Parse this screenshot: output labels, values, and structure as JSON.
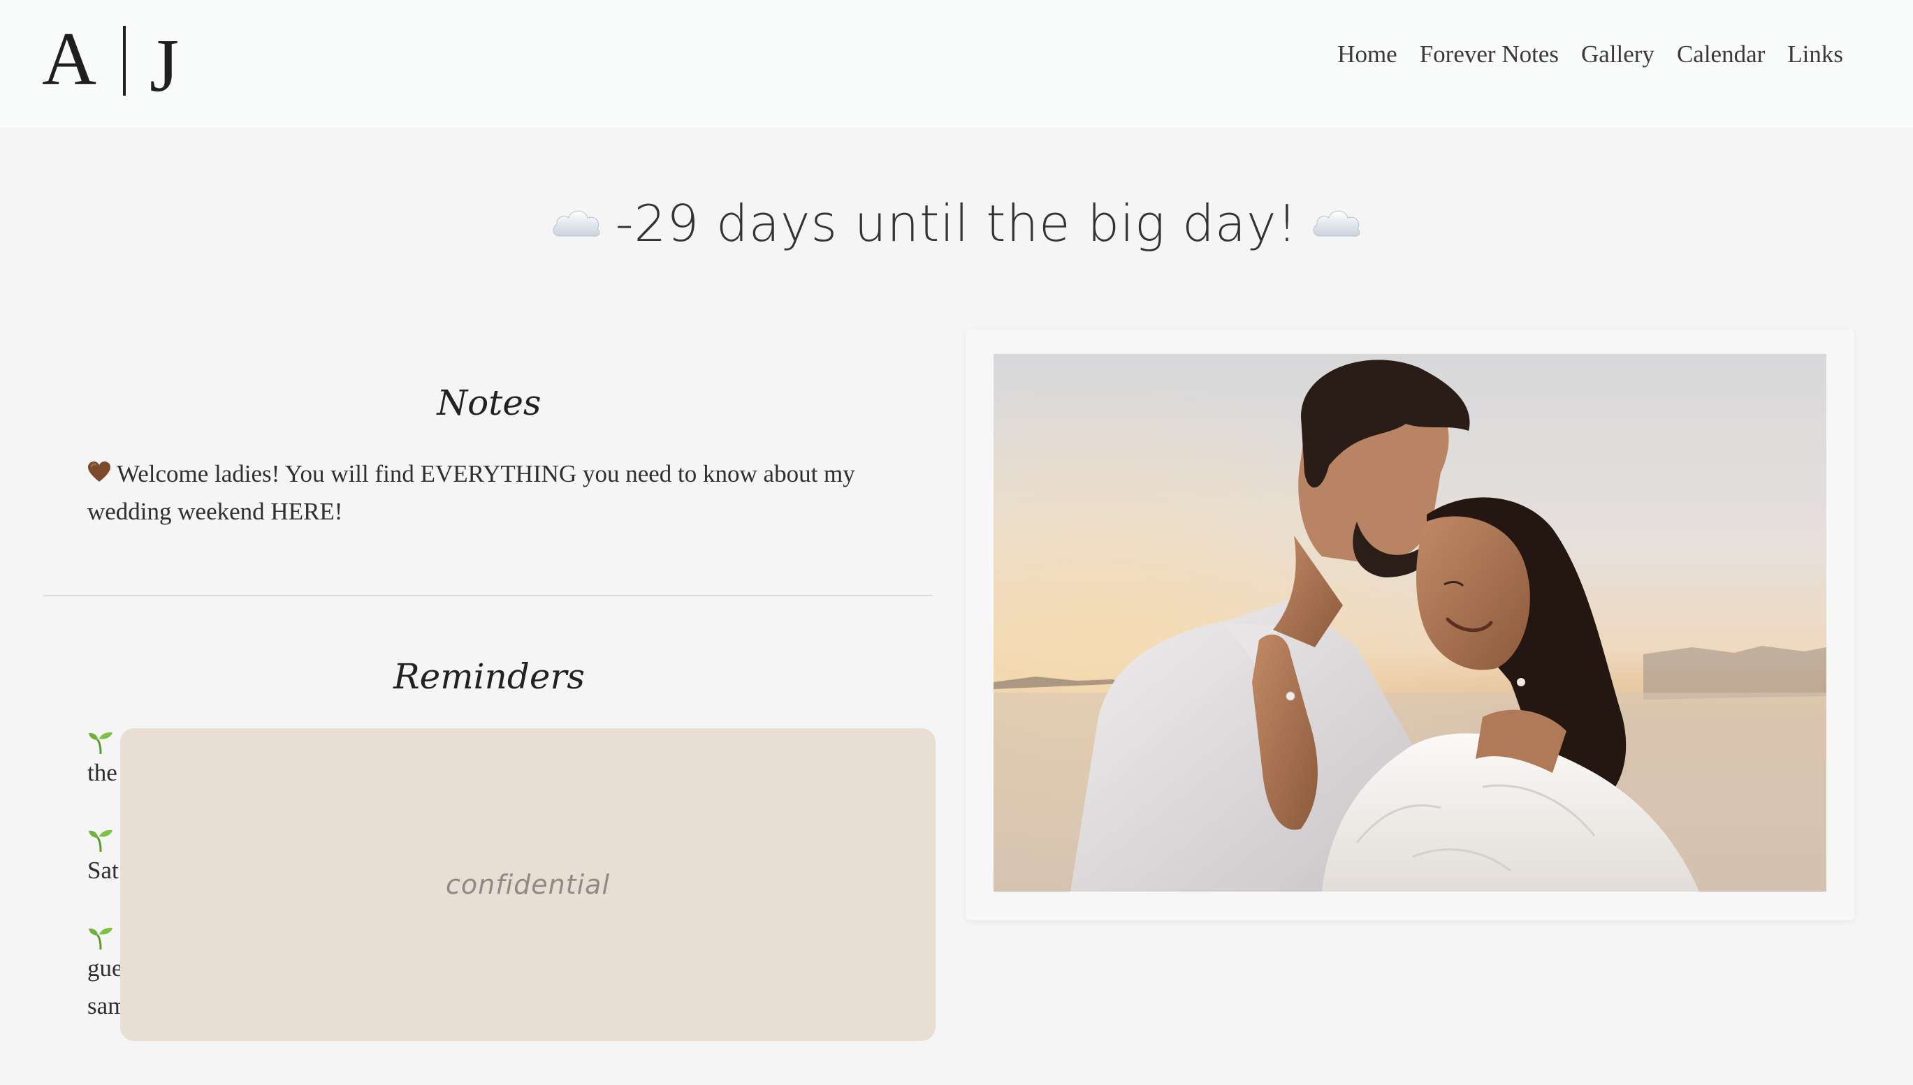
{
  "header": {
    "logo": {
      "left": "A",
      "right": "J"
    },
    "nav": [
      "Home",
      "Forever Notes",
      "Gallery",
      "Calendar",
      "Links"
    ]
  },
  "countdown": {
    "text": "-29 days until the big day!",
    "icon": "cloud-icon"
  },
  "notes": {
    "title": "Notes",
    "icon": "brown-heart-icon",
    "text": "Welcome ladies! You will find EVERYTHING you need to know about my wedding weekend HERE!"
  },
  "reminders": {
    "title": "Reminders",
    "icon": "sprout-icon",
    "items": [
      {
        "visible_text": "the"
      },
      {
        "visible_text": "Sat"
      },
      {
        "visible_text": "gue",
        "visible_text_2": "sam"
      }
    ],
    "overlay_label": "confidential"
  },
  "photo": {
    "alt": "couple-engagement-photo"
  },
  "colors": {
    "background": "#f5f5f5",
    "header": "#f9fafa",
    "overlay": "#e8ded3",
    "text": "#2a2a2a"
  }
}
